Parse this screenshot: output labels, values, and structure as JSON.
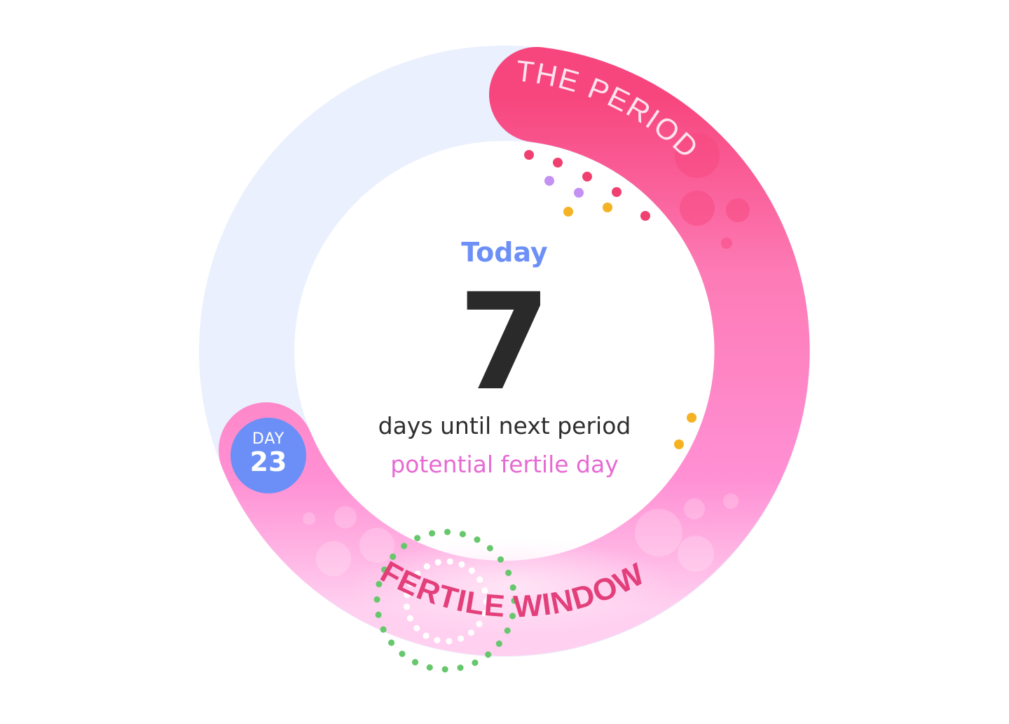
{
  "cycle": {
    "today_label": "Today",
    "days_count": "7",
    "days_caption": "days until next period",
    "fertile_caption": "potential fertile day",
    "period_label": "THE PERIOD",
    "fertile_window_label": "FERTILE WINDOW",
    "day_badge": {
      "label": "DAY",
      "number": "23"
    }
  },
  "colors": {
    "track": "#eaf0fd",
    "period": "#f7457d",
    "fertile": "#ff7fc8",
    "today": "#6d90f7",
    "badge": "#6b8ff6",
    "fertile_text": "#e76ad3",
    "ovulation_dots": "#67c76c"
  }
}
